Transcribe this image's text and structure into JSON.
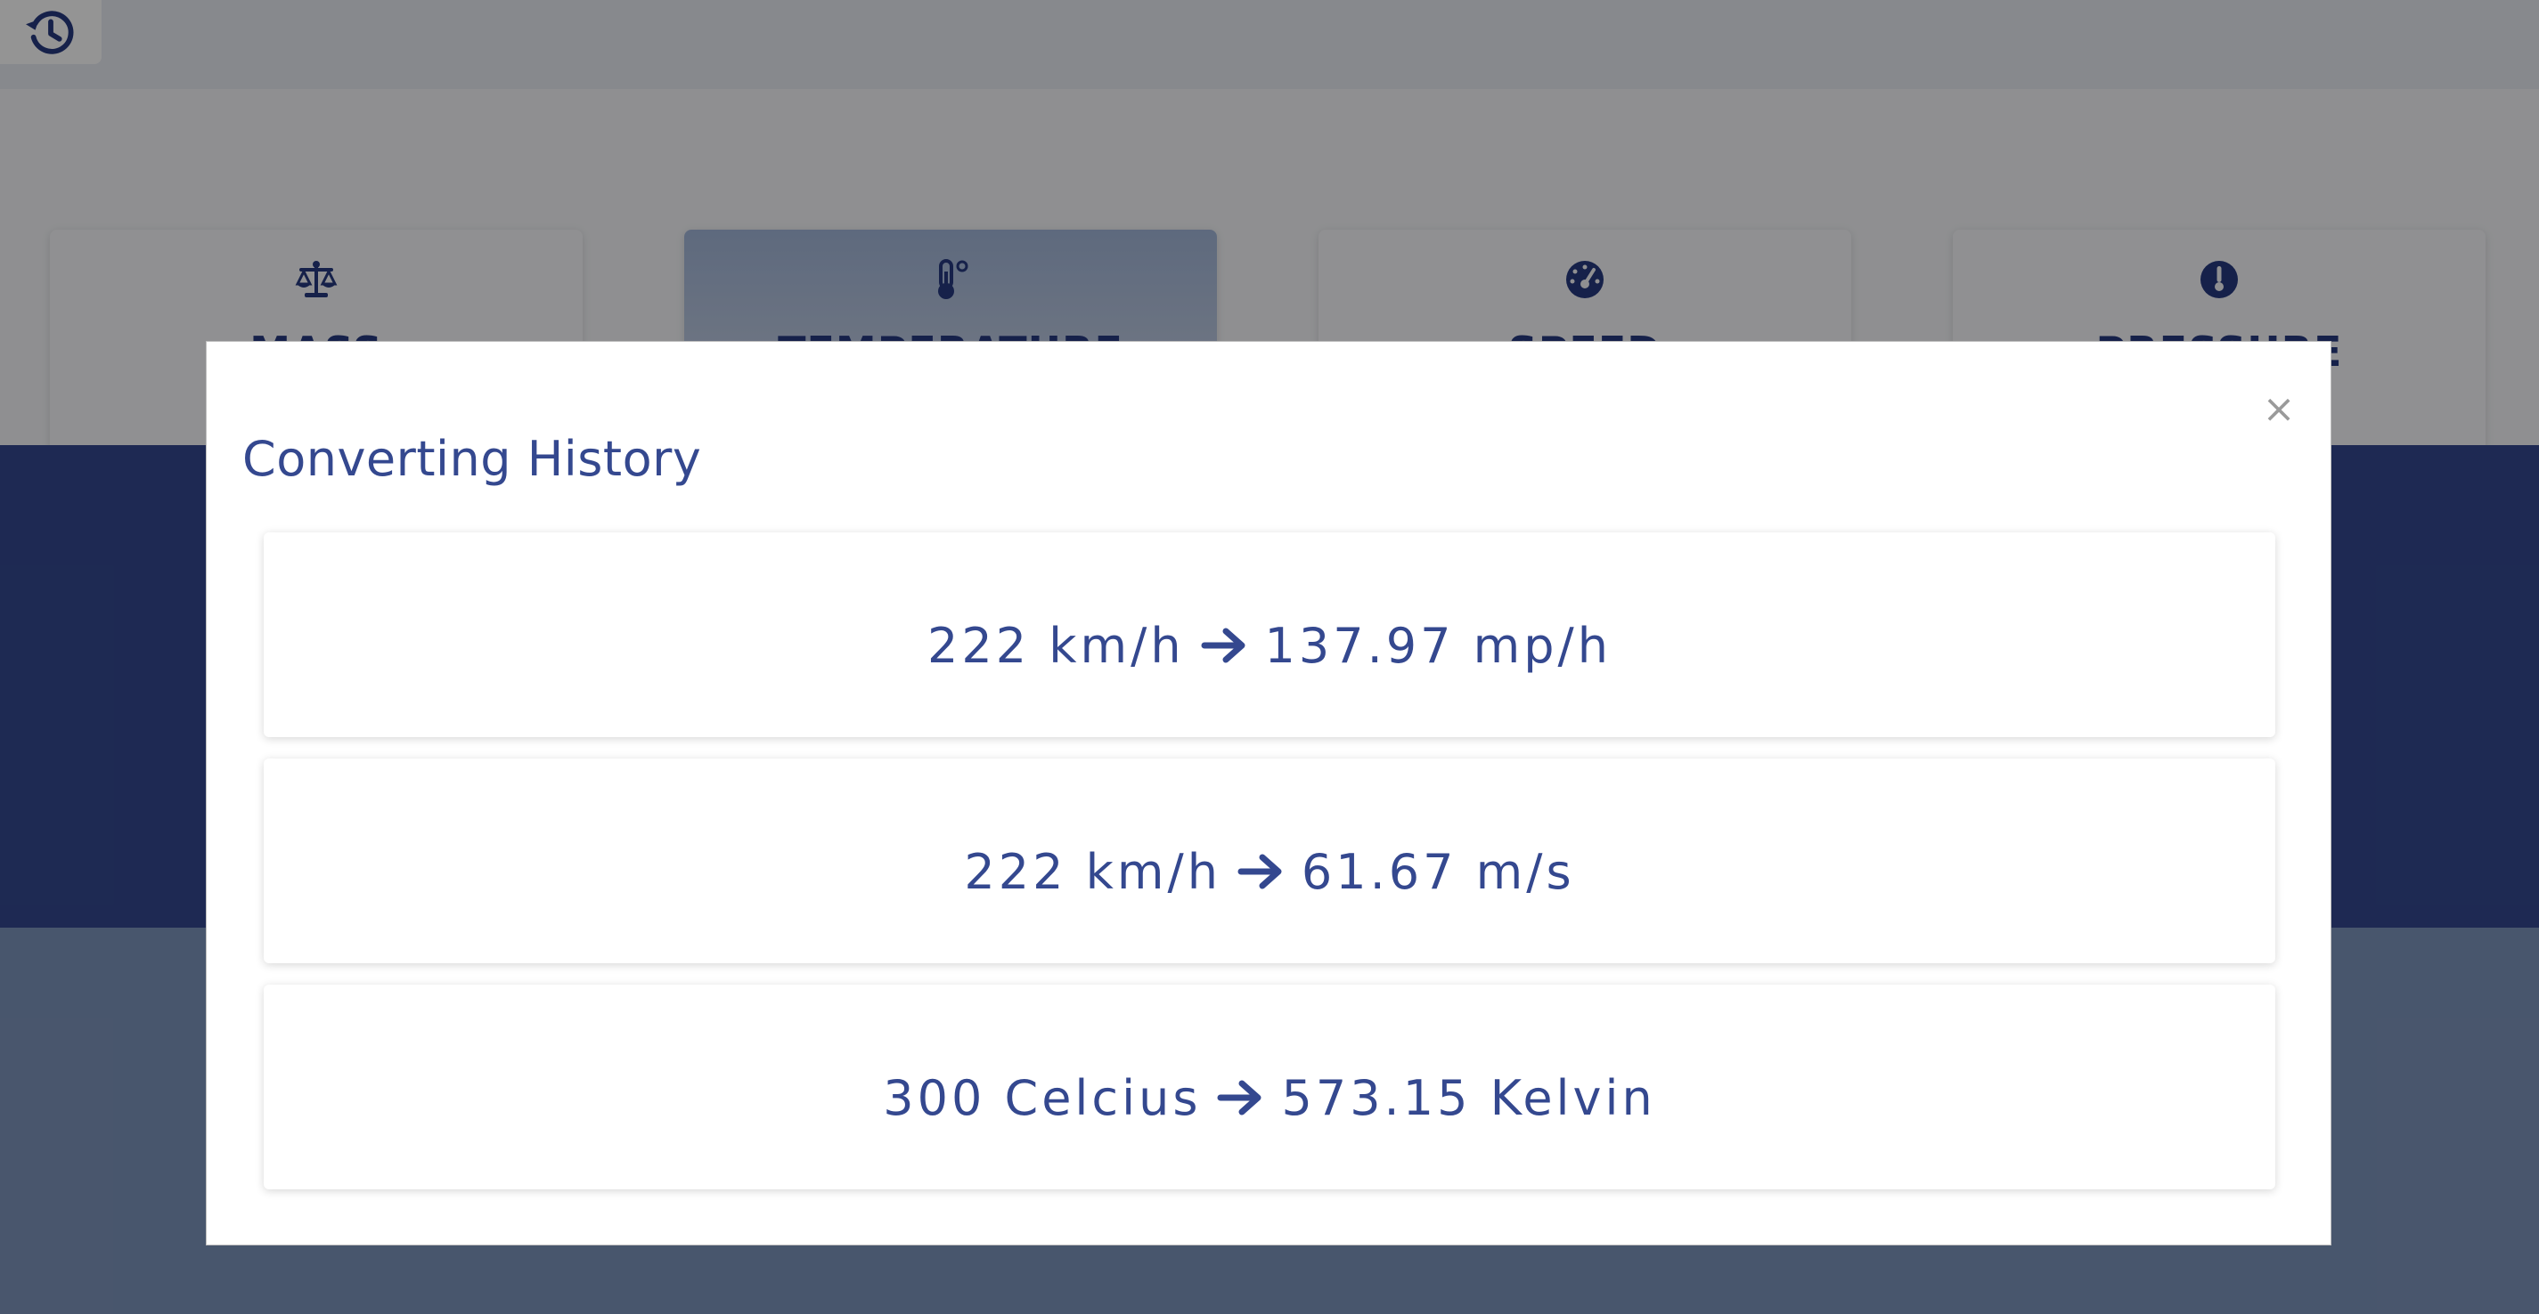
{
  "toolbar": {
    "history_icon": "history-icon"
  },
  "categories": [
    {
      "label": "MASS",
      "icon": "balance-scale-icon",
      "active": false
    },
    {
      "label": "TEMPERATURE",
      "icon": "thermometer-icon",
      "active": true
    },
    {
      "label": "SPEED",
      "icon": "speedometer-icon",
      "active": false
    },
    {
      "label": "PRESSURE",
      "icon": "pressure-gauge-icon",
      "active": false
    }
  ],
  "modal": {
    "title": "Converting History",
    "close_label": "×",
    "items": [
      {
        "from": "222 km/h",
        "to": "137.97 mp/h"
      },
      {
        "from": "222 km/h",
        "to": "61.67 m/s"
      },
      {
        "from": "300 Celcius",
        "to": "573.15 Kelvin"
      }
    ]
  },
  "colors": {
    "primary": "#263a80",
    "accent": "#34488f",
    "overlay": "#00000069"
  }
}
